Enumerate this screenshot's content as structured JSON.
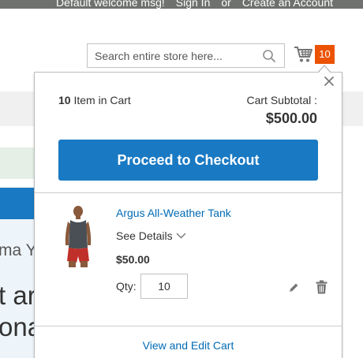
{
  "header": {
    "welcome": "Default welcome msg!",
    "sign_in": "Sign In",
    "or": "or",
    "create_account": "Create an Account"
  },
  "search": {
    "placeholder": "Search entire store here..."
  },
  "cart": {
    "counter": "10"
  },
  "background": {
    "text_1": "ma Y",
    "text_2_line1": "t ar",
    "text_2_line2": "ona"
  },
  "minicart": {
    "items_count": "10",
    "items_label": "Item in Cart",
    "subtotal_label": "Cart Subtotal :",
    "subtotal_price": "$500.00",
    "checkout_label": "Proceed to Checkout",
    "view_cart_label": "View and Edit Cart",
    "item": {
      "name": "Argus All-Weather Tank",
      "see_details": "See Details",
      "price": "$50.00",
      "qty_label": "Qty:",
      "qty_value": "10"
    }
  },
  "colors": {
    "accent": "#1979c3",
    "counter": "#eb5202",
    "link": "#006bb4",
    "topbar": "#6e716e"
  }
}
